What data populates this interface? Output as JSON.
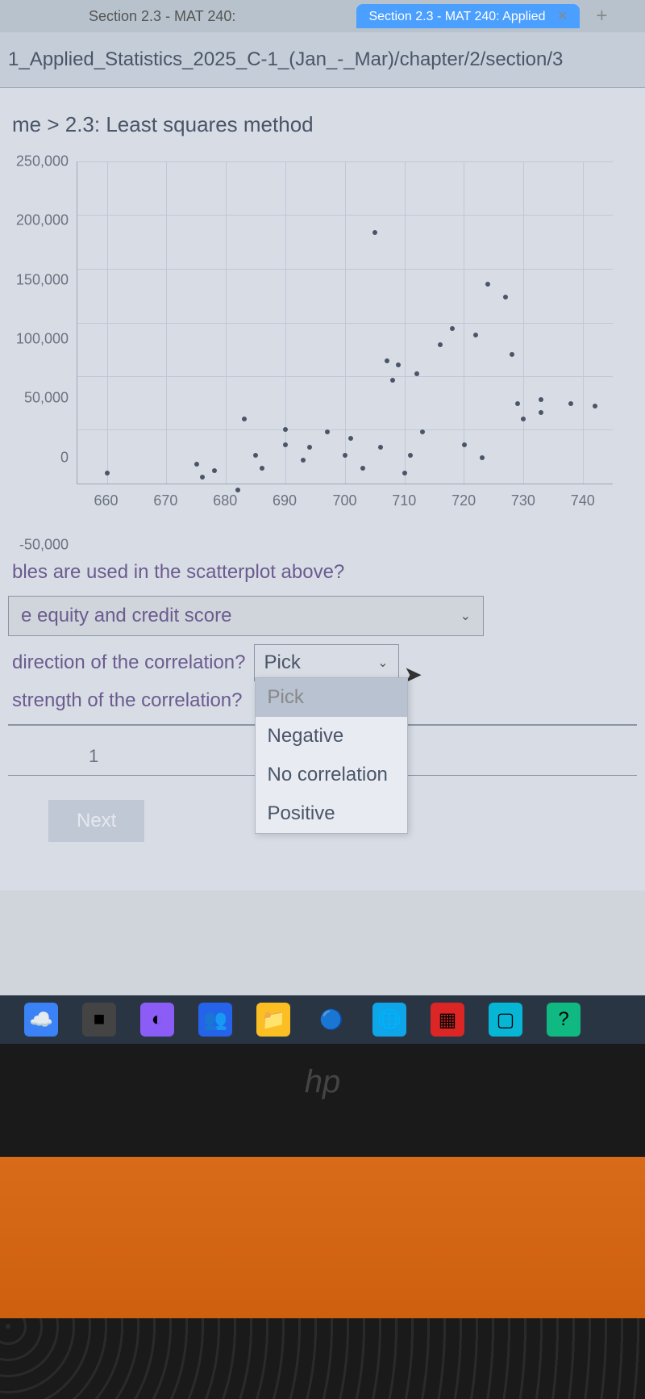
{
  "browser": {
    "tab_title": "Section 2.3 - MAT 240: Applied",
    "tab_close": "✕",
    "plus": "+",
    "url": "1_Applied_Statistics_2025_C-1_(Jan_-_Mar)/chapter/2/section/3"
  },
  "breadcrumb": "me > 2.3: Least squares method",
  "chart_data": {
    "type": "scatter",
    "xlabel": "",
    "ylabel": "",
    "xlim": [
      655,
      745
    ],
    "ylim": [
      -50000,
      250000
    ],
    "x_ticks": [
      "660",
      "670",
      "680",
      "690",
      "700",
      "710",
      "720",
      "730",
      "740"
    ],
    "y_ticks": [
      "-50,000",
      "0",
      "50,000",
      "100,000",
      "150,000",
      "200,000",
      "250,000"
    ],
    "points": [
      {
        "x": 660,
        "y": 8000
      },
      {
        "x": 675,
        "y": 15000
      },
      {
        "x": 676,
        "y": 5000
      },
      {
        "x": 678,
        "y": 10000
      },
      {
        "x": 682,
        "y": -5000
      },
      {
        "x": 683,
        "y": 50000
      },
      {
        "x": 685,
        "y": 22000
      },
      {
        "x": 686,
        "y": 12000
      },
      {
        "x": 690,
        "y": 42000
      },
      {
        "x": 690,
        "y": 30000
      },
      {
        "x": 693,
        "y": 18000
      },
      {
        "x": 694,
        "y": 28000
      },
      {
        "x": 697,
        "y": 40000
      },
      {
        "x": 700,
        "y": 22000
      },
      {
        "x": 701,
        "y": 35000
      },
      {
        "x": 703,
        "y": 12000
      },
      {
        "x": 705,
        "y": 195000
      },
      {
        "x": 706,
        "y": 28000
      },
      {
        "x": 707,
        "y": 95000
      },
      {
        "x": 708,
        "y": 80000
      },
      {
        "x": 709,
        "y": 92000
      },
      {
        "x": 710,
        "y": 8000
      },
      {
        "x": 711,
        "y": 22000
      },
      {
        "x": 712,
        "y": 85000
      },
      {
        "x": 713,
        "y": 40000
      },
      {
        "x": 716,
        "y": 108000
      },
      {
        "x": 718,
        "y": 120000
      },
      {
        "x": 720,
        "y": 30000
      },
      {
        "x": 722,
        "y": 115000
      },
      {
        "x": 723,
        "y": 20000
      },
      {
        "x": 724,
        "y": 155000
      },
      {
        "x": 727,
        "y": 145000
      },
      {
        "x": 728,
        "y": 100000
      },
      {
        "x": 729,
        "y": 62000
      },
      {
        "x": 730,
        "y": 50000
      },
      {
        "x": 733,
        "y": 55000
      },
      {
        "x": 733,
        "y": 65000
      },
      {
        "x": 738,
        "y": 62000
      },
      {
        "x": 742,
        "y": 60000
      }
    ]
  },
  "questions": {
    "variables": "bles are used in the scatterplot above?",
    "variables_answer": "e equity and credit score",
    "direction": "direction of the correlation?",
    "direction_value": "Pick",
    "strength": "strength of the correlation?",
    "strength_value": "Pick"
  },
  "dropdown": {
    "options": [
      "Pick",
      "Negative",
      "No correlation",
      "Positive"
    ]
  },
  "page_number": "1",
  "next_button": "Next",
  "hp": "hp"
}
